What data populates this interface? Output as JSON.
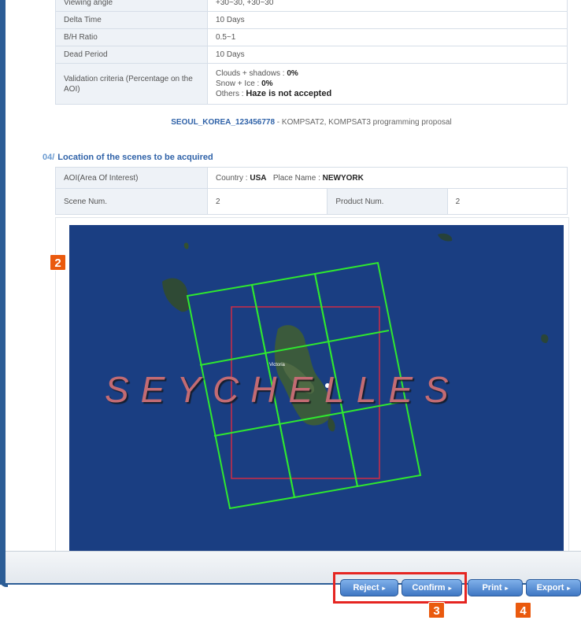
{
  "params_table": {
    "rows": [
      {
        "label": "Viewing angle",
        "value": "+30~30, +30~30"
      },
      {
        "label": "Delta Time",
        "value": "10 Days"
      },
      {
        "label": "B/H Ratio",
        "value": "0.5~1"
      },
      {
        "label": "Dead Period",
        "value": "10 Days"
      }
    ],
    "validation": {
      "label": "Validation criteria (Percentage on the AOI)",
      "clouds_label": "Clouds + shadows : ",
      "clouds_value": "0%",
      "snow_label": "Snow + Ice : ",
      "snow_value": "0%",
      "others_label": "Others : ",
      "others_value": "Haze is not accepted"
    }
  },
  "proposal": {
    "link": "SEOUL_KOREA_123456778",
    "text": " - KOMPSAT2, KOMPSAT3 programming proposal"
  },
  "section": {
    "number": "04/",
    "title": "Location of the scenes to be acquired"
  },
  "location_table": {
    "aoi_label": "AOI(Area Of Interest)",
    "country_label": "Country : ",
    "country_value": "USA",
    "place_label": "Place Name : ",
    "place_value": "NEWYORK",
    "scene_label": "Scene Num.",
    "scene_value": "2",
    "product_label": "Product Num.",
    "product_value": "2"
  },
  "map": {
    "title": "SEYCHELLES",
    "place_label": "Victoria",
    "colors": {
      "sea": "#1a3e82",
      "scene_grid": "#2fe82f",
      "aoi_box": "#d02c45"
    }
  },
  "markers": {
    "map": "2",
    "confirm": "3",
    "print": "4"
  },
  "buttons": {
    "reject": "Reject",
    "confirm": "Confirm",
    "print": "Print",
    "export": "Export",
    "arrow": "▸"
  },
  "colors": {
    "accent": "#2f62a8",
    "marker": "#ea5a0e",
    "highlight": "#e52521"
  }
}
